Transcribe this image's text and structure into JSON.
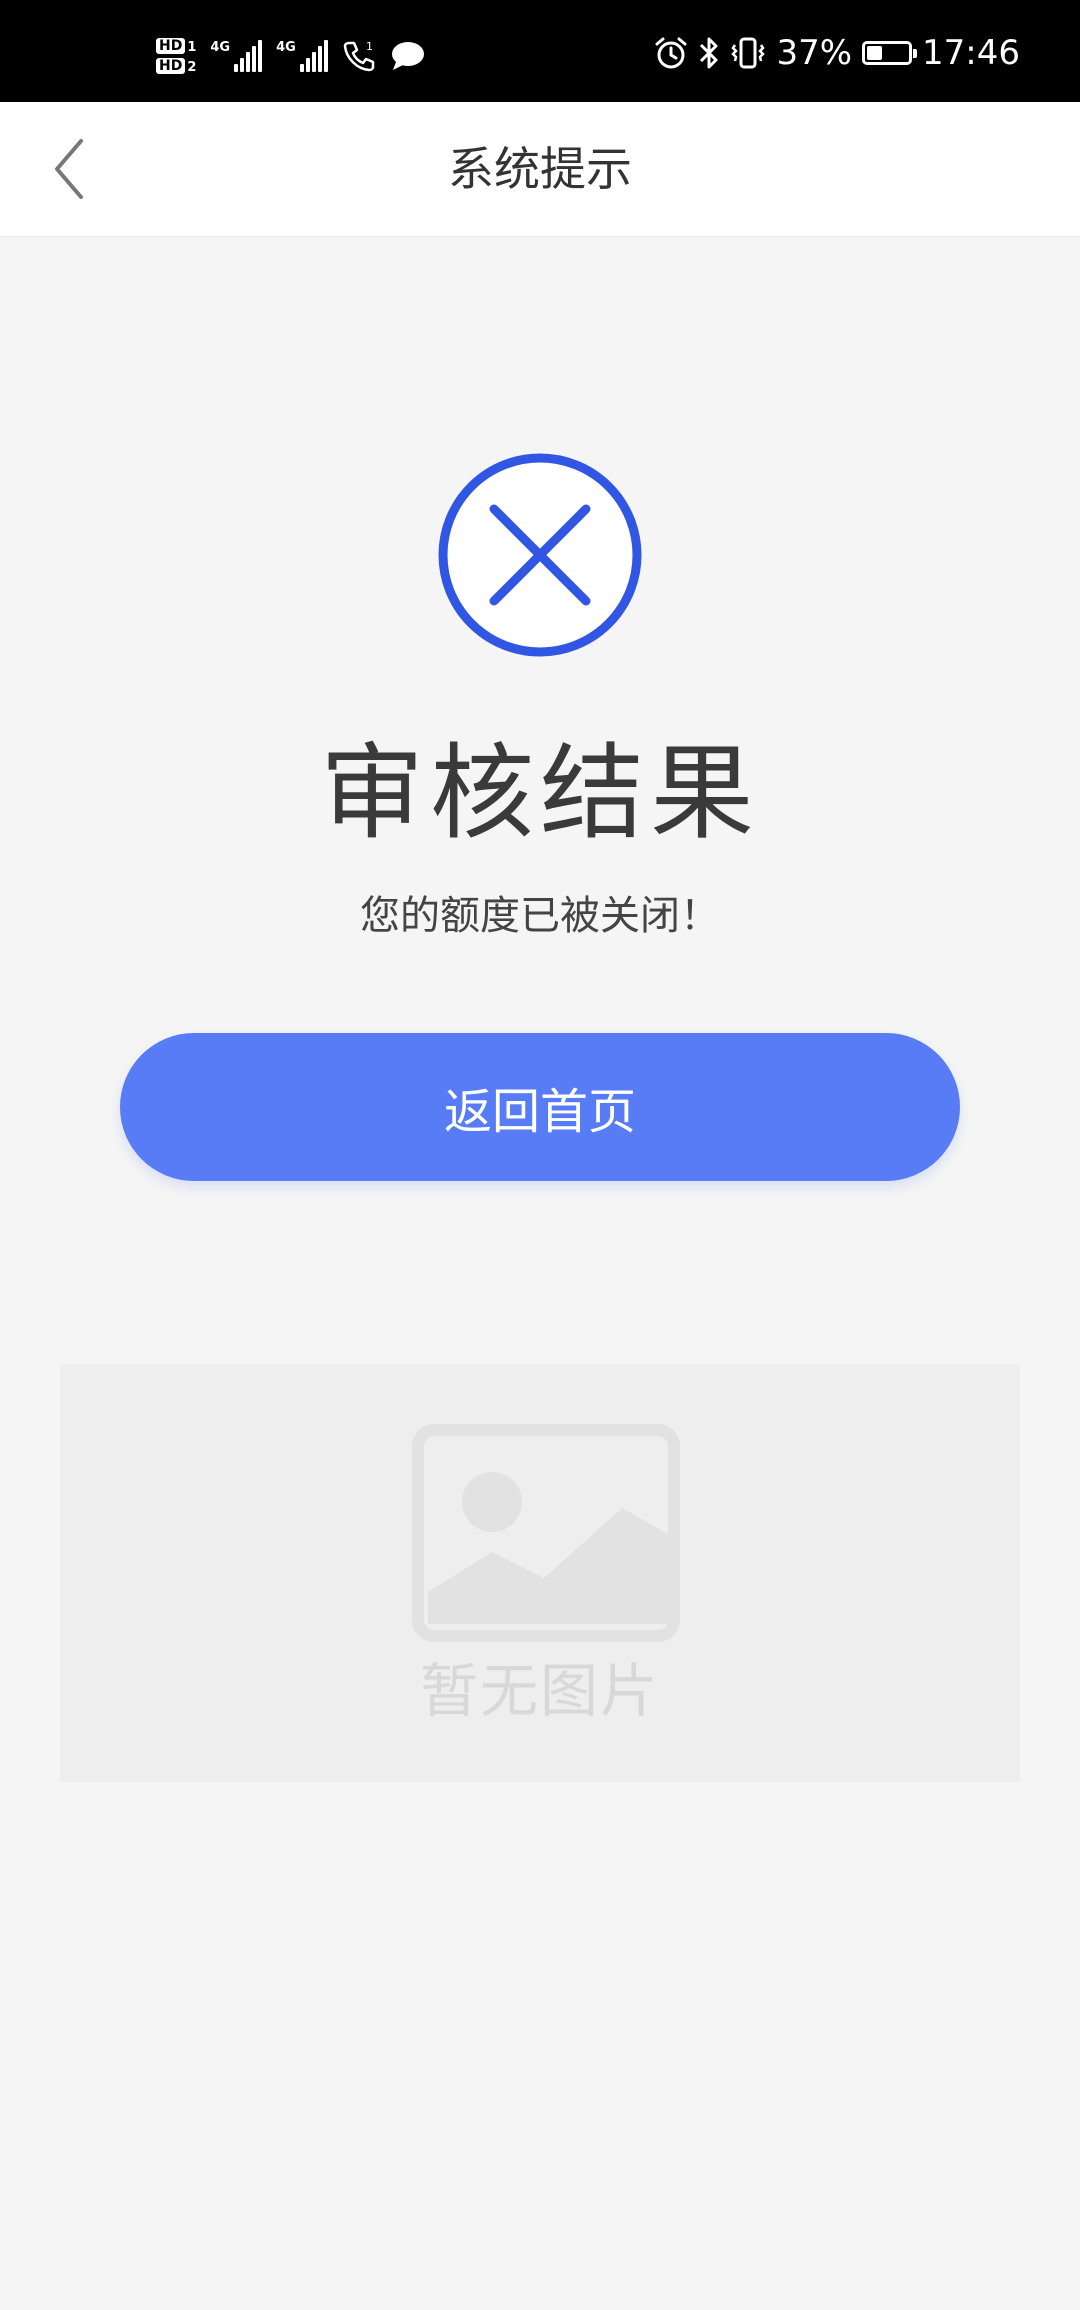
{
  "status_bar": {
    "sim1_label": "HD",
    "sim1_num": "1",
    "sim2_label": "HD",
    "sim2_num": "2",
    "network1": "4G",
    "network2": "4G",
    "battery_percent": "37%",
    "battery_level": 0.37,
    "time": "17:46",
    "icons": [
      "hd-icon",
      "signal-icon",
      "wifi-call-icon",
      "message-icon",
      "alarm-icon",
      "bluetooth-icon",
      "vibrate-icon",
      "battery-icon"
    ]
  },
  "nav": {
    "title": "系统提示",
    "back_icon": "chevron-left-icon"
  },
  "result": {
    "icon": "close-circle-icon",
    "title": "审核结果",
    "message": "您的额度已被关闭！"
  },
  "actions": {
    "home_button_label": "返回首页"
  },
  "placeholder": {
    "icon": "image-icon",
    "text": "暂无图片"
  },
  "colors": {
    "accent": "#577cf5",
    "icon_blue": "#3156e4",
    "background": "#f5f5f5",
    "placeholder_bg": "#eeeeee",
    "placeholder_fg": "#d8d8d8"
  }
}
